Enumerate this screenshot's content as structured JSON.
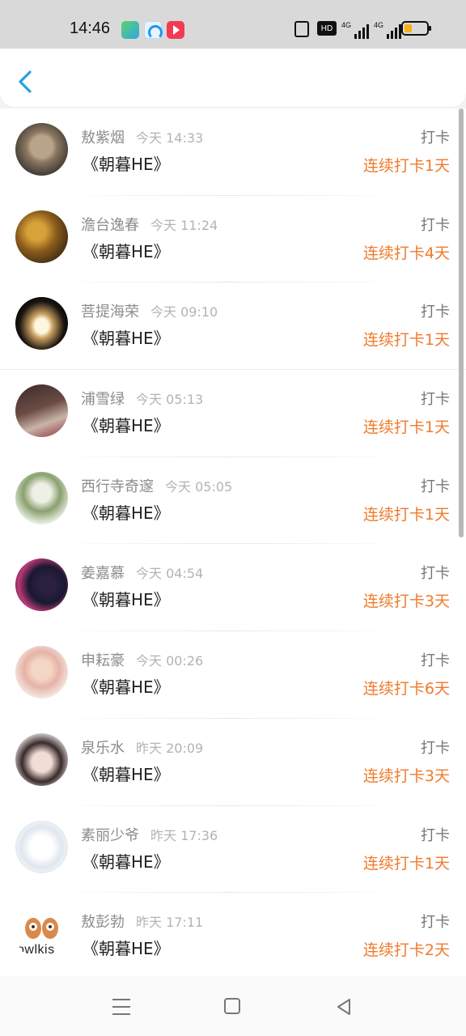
{
  "status_bar": {
    "time": "14:46",
    "hd_label": "HD",
    "net1": "4G",
    "net2": "4G",
    "battery_level": 0.35
  },
  "header": {
    "back_icon": "chevron-left-icon",
    "accent": "#2a9ee6"
  },
  "colors": {
    "streak": "#f07a2c",
    "name": "#8c8c8c",
    "time": "#b3b3b3"
  },
  "rows": [
    {
      "name": "敖紫烟",
      "time": "今天 14:33",
      "title": "《朝暮HE》",
      "action": "打卡",
      "streak": "连续打卡1天",
      "avatar": "cat-avatar"
    },
    {
      "name": "澹台逸春",
      "time": "今天 11:24",
      "title": "《朝暮HE》",
      "action": "打卡",
      "streak": "连续打卡4天",
      "avatar": "autumn-tree-avatar"
    },
    {
      "name": "菩提海荣",
      "time": "今天 09:10",
      "title": "《朝暮HE》",
      "action": "打卡",
      "streak": "连续打卡1天",
      "avatar": "meditation-avatar"
    },
    {
      "name": "浦雪绿",
      "time": "今天 05:13",
      "title": "《朝暮HE》",
      "action": "打卡",
      "streak": "连续打卡1天",
      "avatar": "person-photo-avatar"
    },
    {
      "name": "西行寺奇邃",
      "time": "今天 05:05",
      "title": "《朝暮HE》",
      "action": "打卡",
      "streak": "连续打卡1天",
      "avatar": "anime-boy-avatar"
    },
    {
      "name": "姜嘉慕",
      "time": "今天 04:54",
      "title": "《朝暮HE》",
      "action": "打卡",
      "streak": "连续打卡3天",
      "avatar": "night-girl-avatar"
    },
    {
      "name": "申耘豪",
      "time": "今天 00:26",
      "title": "《朝暮HE》",
      "action": "打卡",
      "streak": "连续打卡6天",
      "avatar": "flower-girl-avatar"
    },
    {
      "name": "泉乐水",
      "time": "昨天 20:09",
      "title": "《朝暮HE》",
      "action": "打卡",
      "streak": "连续打卡3天",
      "avatar": "girl-selfie-avatar"
    },
    {
      "name": "素丽少爷",
      "time": "昨天 17:36",
      "title": "《朝暮HE》",
      "action": "打卡",
      "streak": "连续打卡1天",
      "avatar": "sketch-cat-avatar"
    },
    {
      "name": "敖彭勃",
      "time": "昨天 17:11",
      "title": "《朝暮HE》",
      "action": "打卡",
      "streak": "连续打卡2天",
      "avatar": "owl-logo-avatar",
      "avatar_text": "owlkis"
    }
  ],
  "bottom_nav": {
    "icons": [
      "menu-icon",
      "home-square-icon",
      "back-triangle-icon"
    ]
  }
}
